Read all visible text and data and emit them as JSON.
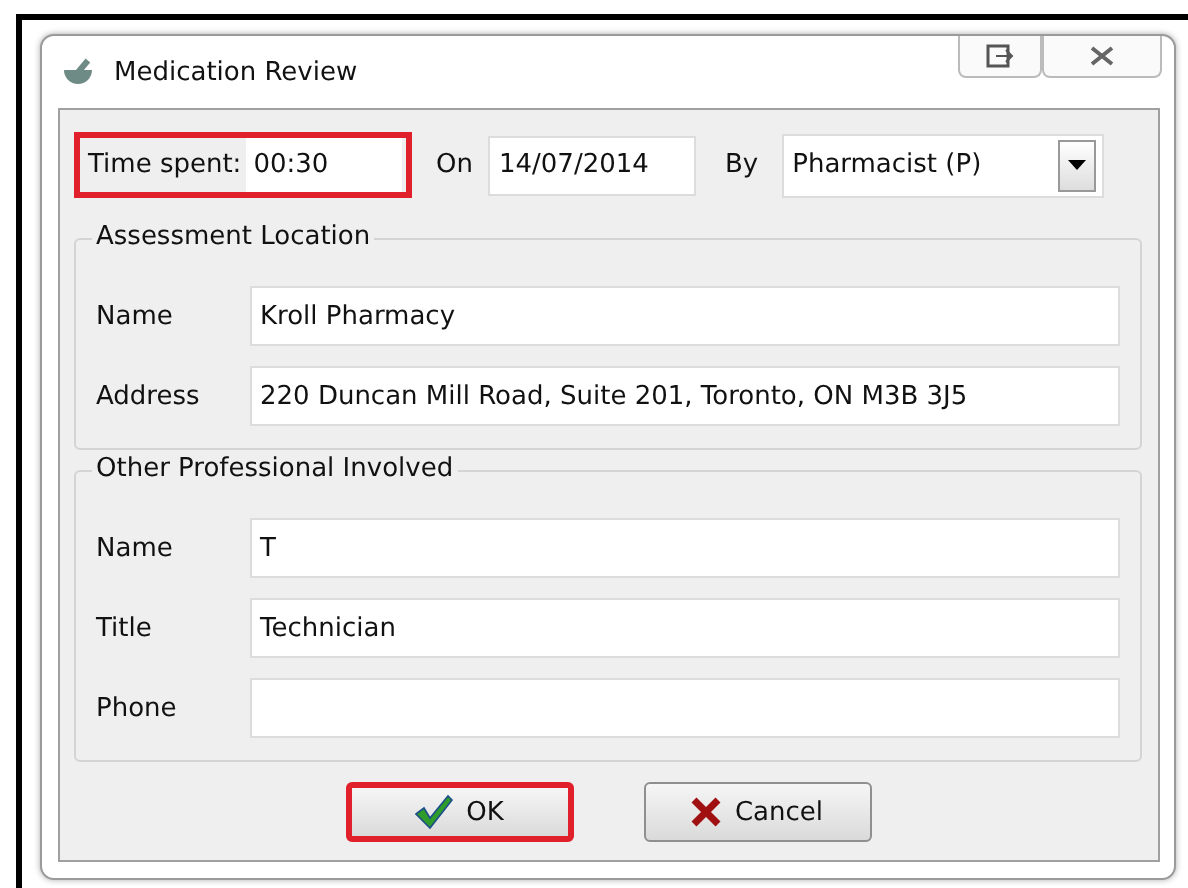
{
  "window": {
    "title": "Medication Review"
  },
  "header": {
    "time_spent": {
      "label": "Time spent:",
      "value": "00:30",
      "highlighted": true
    },
    "on": {
      "label": "On",
      "value": "14/07/2014"
    },
    "by": {
      "label": "By",
      "value": "Pharmacist (P)"
    }
  },
  "groups": [
    {
      "title": "Assessment Location",
      "fields": [
        {
          "label": "Name",
          "value": "Kroll Pharmacy"
        },
        {
          "label": "Address",
          "value": "220 Duncan Mill Road, Suite 201, Toronto, ON M3B 3J5"
        }
      ]
    },
    {
      "title": "Other Professional Involved",
      "fields": [
        {
          "label": "Name",
          "value": "T"
        },
        {
          "label": "Title",
          "value": "Technician"
        },
        {
          "label": "Phone"
        }
      ]
    }
  ],
  "buttons": [
    {
      "label": "OK",
      "kind": "ok",
      "highlighted": true
    },
    {
      "label": "Cancel",
      "kind": "cancel",
      "highlighted": false
    }
  ]
}
